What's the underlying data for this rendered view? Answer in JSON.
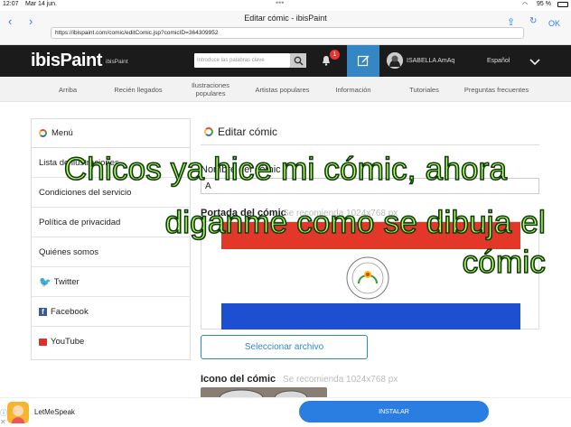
{
  "status": {
    "time": "12:07",
    "date": "Mar 14 jun.",
    "battery": "95 %"
  },
  "browser": {
    "title": "Editar cómic - ibisPaint",
    "url": "https://ibispaint.com/comic/editComic.jsp?comicID=364309952",
    "ok_label": "OK"
  },
  "topbar": {
    "logo": "ibisPaint",
    "brand_small": "ibisPaint",
    "search_placeholder": "Introduce las palabras clave",
    "notif_count": "1",
    "user": "ISABELLA AmAq",
    "language": "Español"
  },
  "nav": {
    "items": [
      "Arriba",
      "Recién llegados",
      "Ilustraciones populares",
      "Artistas populares",
      "Información",
      "Tutoriales",
      "Preguntas frecuentes"
    ]
  },
  "sidebar": {
    "title": "Menú",
    "items": [
      "Lista de ilustraciones",
      "Condiciones del servicio",
      "Política de privacidad",
      "Quiénes somos",
      "Twitter",
      "Facebook",
      "YouTube"
    ]
  },
  "main": {
    "title": "Editar cómic",
    "name_label": "Nombre del cómic",
    "name_value": "A",
    "cover_label": "Portada del cómic",
    "cover_hint": "Se recomienda 1024x768 px",
    "select_file": "Seleccionar archivo",
    "icon_label": "Icono del cómic",
    "icon_hint": "Se recomienda 1024x768 px"
  },
  "overlay": {
    "line1": "Chicos ya hice mi cómic, ahora",
    "line2": "diganme como se dibuja el",
    "line3": "cómic"
  },
  "ad": {
    "app": "LetMeSpeak",
    "install": "INSTALAR"
  },
  "colors": {
    "topbar": "#1b1b1b",
    "accent": "#3486c4",
    "install": "#2a7de1",
    "overlay_text": "#b6ff5a",
    "flag_red": "#e3372a",
    "flag_blue": "#1f4fd1"
  }
}
